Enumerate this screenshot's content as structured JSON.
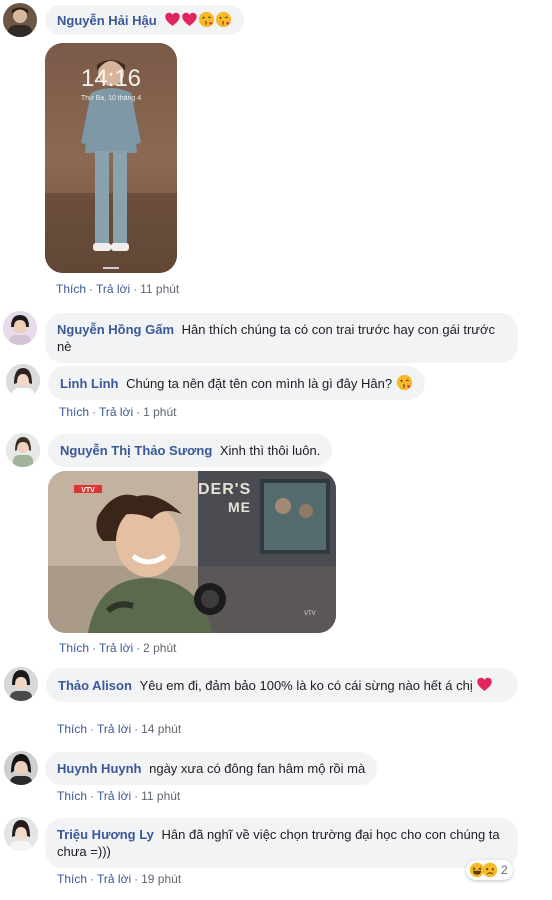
{
  "actions": {
    "like": "Thích",
    "reply": "Trả lời",
    "separator": "·"
  },
  "colors": {
    "author": "#385898",
    "bubble": "#f2f3f5",
    "meta": "#606770"
  },
  "comments": [
    {
      "author": "Nguyễn Hải Hậu",
      "text": "",
      "emojis": [
        "heart-icon",
        "heart-icon",
        "kiss-face-icon",
        "kiss-face-icon"
      ],
      "photo": {
        "clock_time": "14:16",
        "clock_date": "Thứ Ba, 10 tháng 4"
      },
      "time": "11 phút"
    },
    {
      "author": "Nguyễn Hồng Gấm",
      "text": "Hân thích chúng ta có con trai trước hay con gái trước nè",
      "time": ""
    },
    {
      "author": "Linh Linh",
      "text": "Chúng ta nên đặt tên con mình là gì đây Hân?",
      "emojis": [
        "kiss-face-icon"
      ],
      "time": "1 phút"
    },
    {
      "author": "Nguyễn Thị Thảo Sương",
      "text": "Xinh thì thôi luôn.",
      "photo": {
        "banner_text": "DER'S",
        "banner_text_2": "ME"
      },
      "time": "2 phút"
    },
    {
      "author": "Thảo Alison",
      "text": "Yêu em đi, đảm bảo 100% là ko có cái sừng nào hết á chị",
      "emojis": [
        "heart-icon"
      ],
      "time": "14 phút"
    },
    {
      "author": "Huynh Huynh",
      "text": "ngày xưa có đông fan hâm mộ rồi mà",
      "time": "11 phút"
    },
    {
      "author": "Triệu Hương Ly",
      "text": "Hân đã nghĩ về việc chọn trường đại học cho con chúng ta chưa =)))",
      "time": "19 phút",
      "reactions": {
        "icons": [
          "haha-icon",
          "sad-icon"
        ],
        "count": "2"
      }
    }
  ]
}
